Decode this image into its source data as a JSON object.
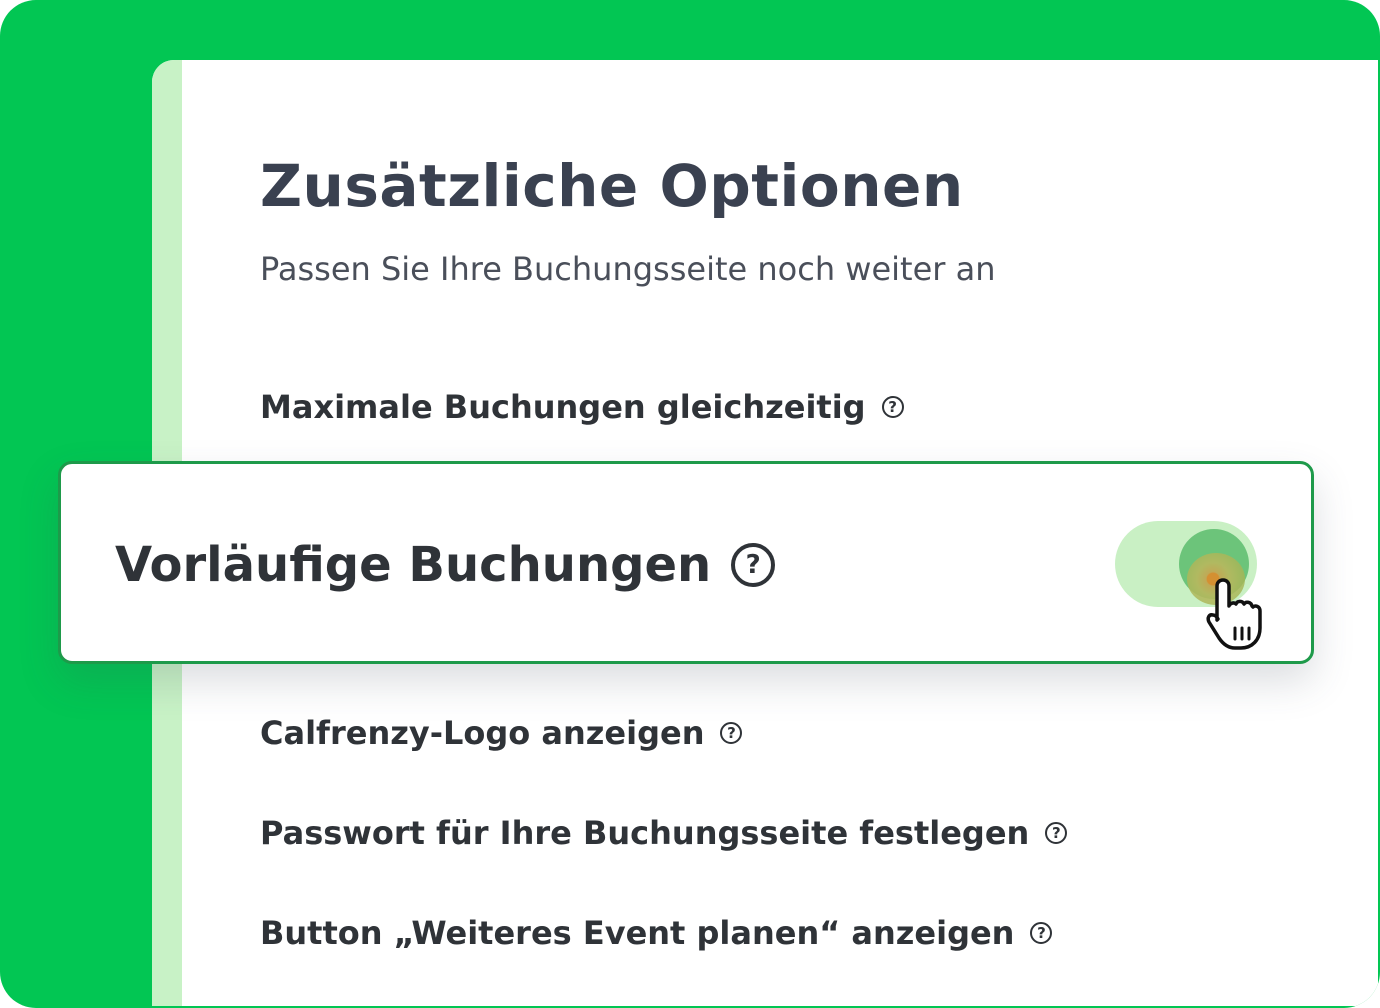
{
  "colors": {
    "brand_green": "#02c653",
    "panel_stripe": "#c8f2c6",
    "card_border": "#1e9a4a",
    "toggle_track": "#c9f0c4",
    "toggle_knob": "#6cc47a",
    "heading_text": "#3a4150",
    "body_text": "#2f3338"
  },
  "header": {
    "title": "Zusätzliche Optionen",
    "subtitle": "Passen Sie Ihre Buchungsseite noch weiter an"
  },
  "options": {
    "max_bookings": "Maximale Buchungen gleichzeitig",
    "show_logo": "Calfrenzy-Logo anzeigen",
    "password": "Passwort für Ihre Buchungsseite festlegen",
    "schedule_button": "Button „Weiteres Event planen“ anzeigen"
  },
  "highlight": {
    "label": "Vorläufige Buchungen",
    "toggle_state": "on"
  },
  "icons": {
    "help": "question-circle-icon",
    "cursor": "hand-pointer-icon"
  },
  "help_glyph": "?"
}
